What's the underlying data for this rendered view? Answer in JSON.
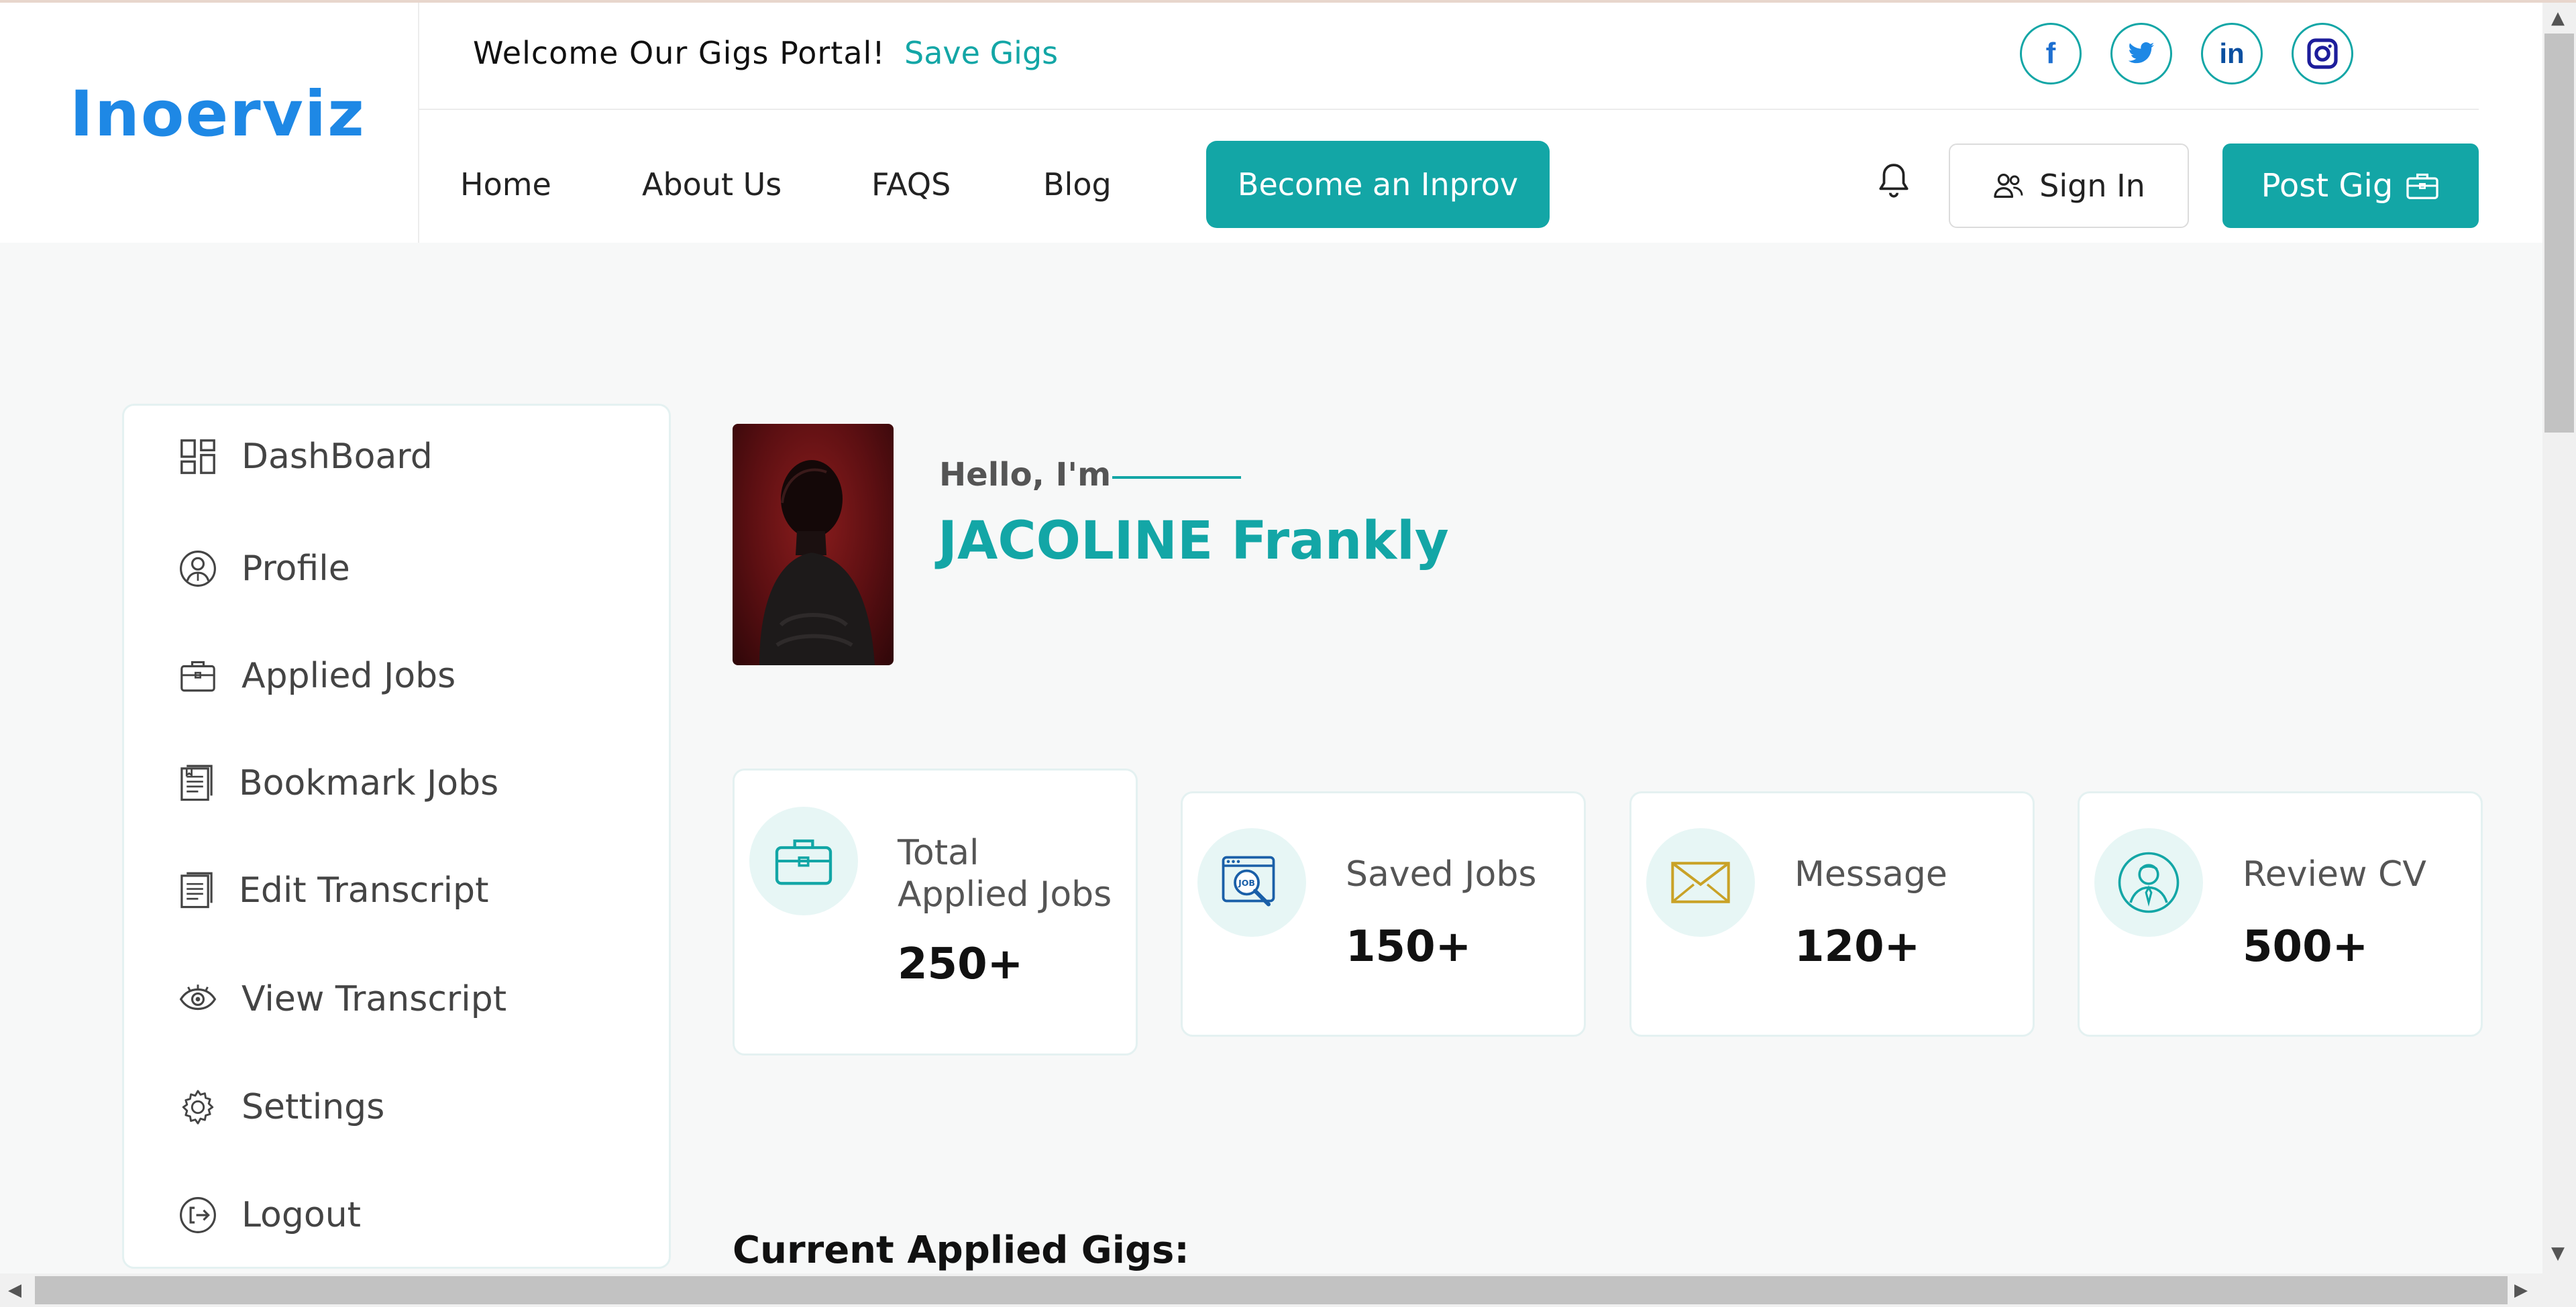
{
  "brand": {
    "logo_text": "Inoerviz",
    "accent": "#13a6a6",
    "logo_color": "#1e88e5"
  },
  "topbar": {
    "welcome": "Welcome Our Gigs Portal!",
    "save_gigs": "Save Gigs",
    "social": [
      {
        "icon": "facebook-icon",
        "text": "f"
      },
      {
        "icon": "twitter-icon",
        "text": ""
      },
      {
        "icon": "linkedin-icon",
        "text": "in"
      },
      {
        "icon": "instagram-icon",
        "text": ""
      }
    ]
  },
  "nav": {
    "links": [
      "Home",
      "About Us",
      "FAQS",
      "Blog"
    ],
    "become": "Become an Inprov",
    "sign_in": "Sign In",
    "post_gig": "Post Gig"
  },
  "sidebar": {
    "items": [
      {
        "label": "DashBoard",
        "icon": "dashboard-icon"
      },
      {
        "label": "Profile",
        "icon": "profile-icon"
      },
      {
        "label": "Applied Jobs",
        "icon": "briefcase-icon"
      },
      {
        "label": "Bookmark Jobs",
        "icon": "bookmark-document-icon"
      },
      {
        "label": "Edit Transcript",
        "icon": "edit-document-icon"
      },
      {
        "label": "View Transcript",
        "icon": "eye-icon"
      },
      {
        "label": "Settings",
        "icon": "gear-icon"
      },
      {
        "label": "Logout",
        "icon": "logout-icon"
      }
    ]
  },
  "profile": {
    "hello": "Hello, I'm",
    "name": "JACOLINE Frankly"
  },
  "stats": [
    {
      "label": "Total Applied Jobs",
      "value": "250+",
      "icon": "briefcase-icon"
    },
    {
      "label": "Saved Jobs",
      "value": "150+",
      "icon": "job-search-icon",
      "badge": "JOB"
    },
    {
      "label": "Message",
      "value": "120+",
      "icon": "envelope-icon"
    },
    {
      "label": "Review CV",
      "value": "500+",
      "icon": "person-icon"
    }
  ],
  "section": {
    "current_applied": "Current Applied Gigs:"
  }
}
